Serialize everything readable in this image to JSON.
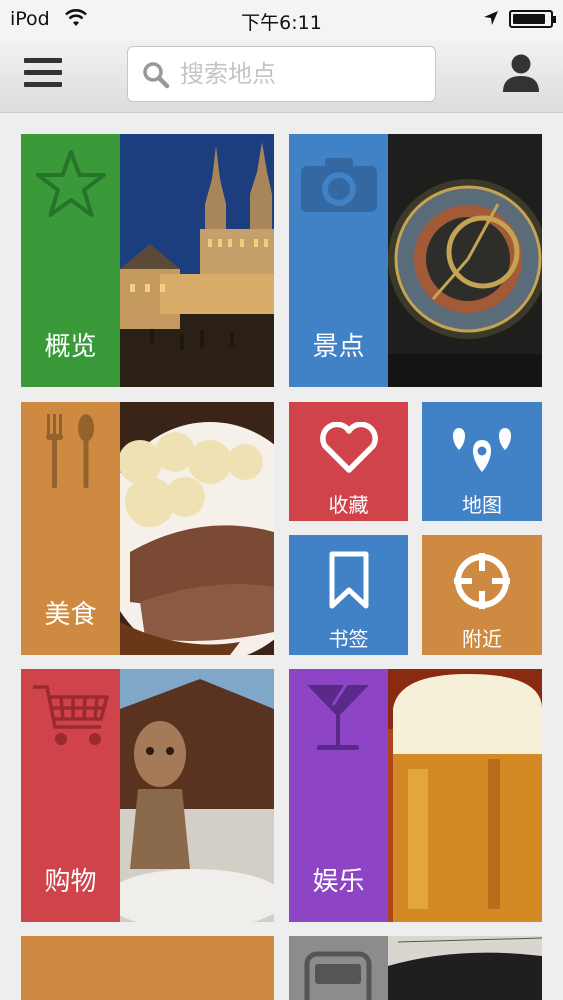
{
  "status_bar": {
    "carrier": "iPod",
    "time": "下午6:11",
    "battery_level": 0.9
  },
  "nav": {
    "search_placeholder": "搜索地点",
    "icons": [
      "menu-icon",
      "search-icon",
      "person-icon"
    ]
  },
  "tiles": {
    "overview": {
      "label": "概览",
      "color": "#3a9a3a",
      "icon": "star-icon"
    },
    "sights": {
      "label": "景点",
      "color": "#4181c6",
      "icon": "camera-icon"
    },
    "food": {
      "label": "美食",
      "color": "#cf8a41",
      "icon": "fork-spoon-icon"
    },
    "favorites": {
      "label": "收藏",
      "color": "#d0434a",
      "icon": "heart-icon"
    },
    "map": {
      "label": "地图",
      "color": "#4181c6",
      "icon": "map-pins-icon"
    },
    "bookmarks": {
      "label": "书签",
      "color": "#4181c6",
      "icon": "bookmark-icon"
    },
    "nearby": {
      "label": "附近",
      "color": "#cf8a41",
      "icon": "crosshair-icon"
    },
    "shopping": {
      "label": "购物",
      "color": "#d0434a",
      "icon": "cart-icon"
    },
    "entertainment": {
      "label": "娱乐",
      "color": "#8d45c6",
      "icon": "cocktail-icon"
    },
    "transport": {
      "color": "#8c8c8c",
      "icon": "bus-icon"
    },
    "partial_orange": {
      "color": "#cf8a41"
    }
  }
}
